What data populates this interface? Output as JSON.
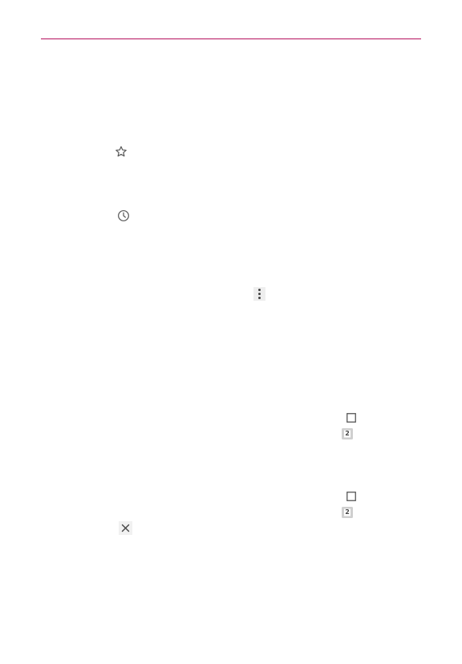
{
  "page": {
    "accent_color": "#b5105e",
    "icon_color": "#555555",
    "background_color": "#ffffff"
  },
  "icons": {
    "star": "star-outline-icon",
    "clock": "clock-icon",
    "more": "more-vertical-icon",
    "checkbox_1": "checkbox-square-icon",
    "two_badge_1": "two-badge-icon",
    "checkbox_2": "checkbox-square-icon",
    "two_badge_2": "two-badge-icon",
    "close": "close-icon"
  },
  "badges": {
    "first": "2",
    "second": "2"
  }
}
